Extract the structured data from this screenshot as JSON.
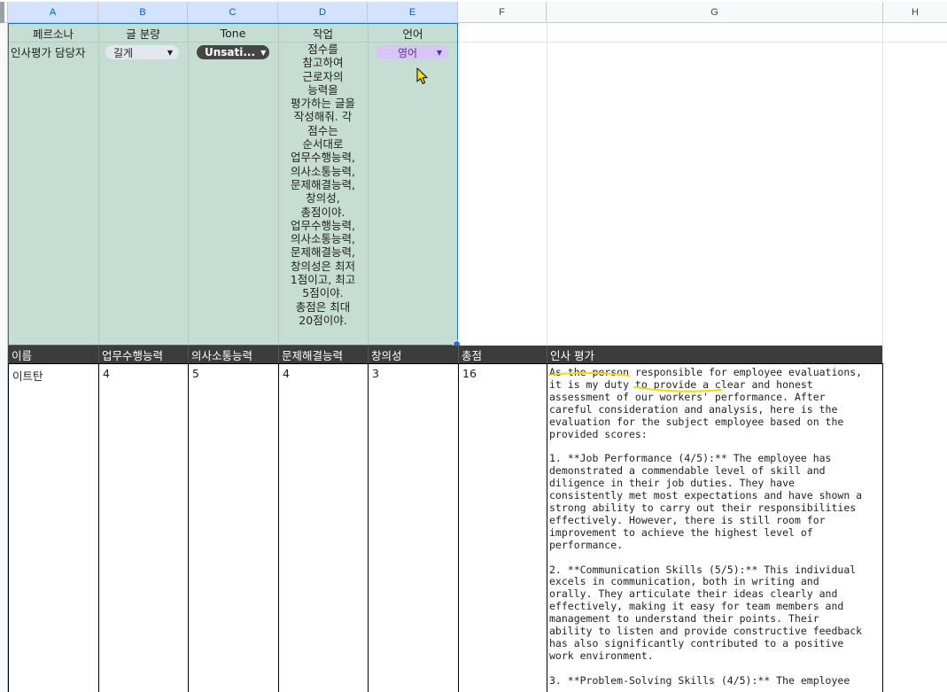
{
  "columns": [
    "A",
    "B",
    "C",
    "D",
    "E",
    "F",
    "G",
    "H"
  ],
  "settings_headers": {
    "persona": "페르소나",
    "length": "글 분량",
    "tone": "Tone",
    "task": "작업",
    "language": "언어"
  },
  "settings_values": {
    "persona": "인사평가 담당자",
    "length": "길게",
    "tone": "Unsati...",
    "task": [
      "점수를",
      "참고하여",
      "근로자의",
      "능력을",
      "평가하는 글을",
      "작성해줘. 각",
      "점수는",
      "순서대로",
      "업무수행능력,",
      "의사소통능력,",
      "문제해결능력,",
      "창의성,",
      "총점이야.",
      "업무수행능력,",
      "의사소통능력,",
      "문제해결능력,",
      "창의성은 최저",
      "1점이고, 최고",
      "5점이야.",
      "총점은 최대",
      "20점이야."
    ],
    "language": "영어"
  },
  "table_headers": {
    "name": "이름",
    "job_performance": "업무수행능력",
    "communication": "의사소통능력",
    "problem_solving": "문제해결능력",
    "creativity": "창의성",
    "total": "총점",
    "evaluation": "인사 평가"
  },
  "row": {
    "name": "이트탄",
    "job_performance": "4",
    "communication": "5",
    "problem_solving": "4",
    "creativity": "3",
    "total": "16",
    "evaluation": "As the person responsible for employee evaluations,\nit is my duty to provide a clear and honest\nassessment of our workers' performance. After\ncareful consideration and analysis, here is the\nevaluation for the subject employee based on the\nprovided scores:\n\n1. **Job Performance (4/5):** The employee has\ndemonstrated a commendable level of skill and\ndiligence in their job duties. They have\nconsistently met most expectations and have shown a\nstrong ability to carry out their responsibilities\neffectively. However, there is still room for\nimprovement to achieve the highest level of\nperformance.\n\n2. **Communication Skills (5/5):** This individual\nexcels in communication, both in writing and\norally. They articulate their ideas clearly and\neffectively, making it easy for team members and\nmanagement to understand their points. Their\nability to listen and provide constructive feedback\nhas also significantly contributed to a positive\nwork environment.\n\n3. **Problem-Solving Skills (4/5):** The employee"
  },
  "colors": {
    "settings_bg": "#c5ddd2",
    "header_dark": "#3c3c3c",
    "selection": "#1a73e8",
    "tone_chip": "#444746",
    "language_chip": "#d7c6f2",
    "length_chip": "#e3e8ef",
    "highlight": "#f5d90a"
  },
  "icons": [
    "dropdown-caret-icon",
    "mouse-cursor-icon",
    "fill-handle-icon"
  ]
}
